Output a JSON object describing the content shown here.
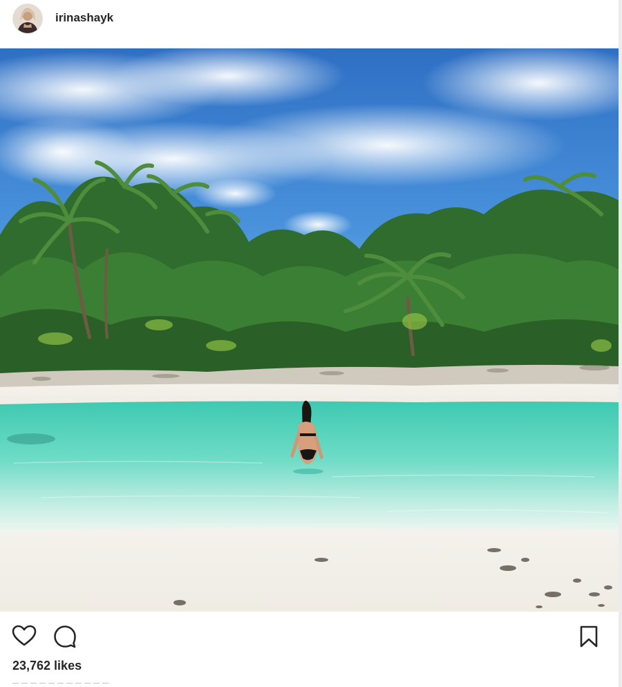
{
  "post": {
    "username": "irinashayk",
    "likes": "23,762 likes"
  },
  "icons": {
    "like": "heart-icon",
    "comment": "comment-icon",
    "save": "bookmark-icon"
  },
  "colors": {
    "text": "#262626",
    "sky": "#3f86d6",
    "water": "#5ed8c3",
    "sand": "#f3f1ec",
    "foliage": "#3b7a34"
  }
}
